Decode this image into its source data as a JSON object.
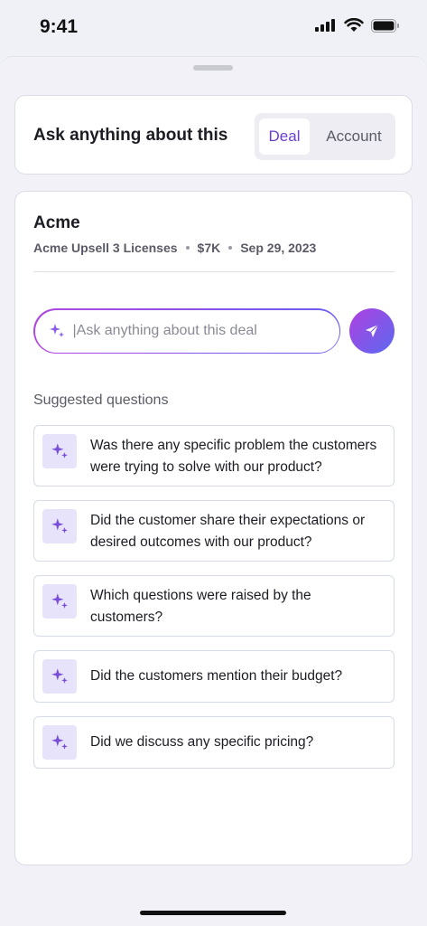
{
  "status_bar": {
    "time": "9:41"
  },
  "ask": {
    "title": "Ask anything about this",
    "tabs": [
      {
        "label": "Deal",
        "selected": true
      },
      {
        "label": "Account",
        "selected": false
      }
    ]
  },
  "deal": {
    "name": "Acme",
    "opportunity": "Acme Upsell 3 Licenses",
    "amount": "$7K",
    "date": "Sep 29, 2023"
  },
  "input": {
    "placeholder": "|Ask anything about this deal"
  },
  "suggested": {
    "title": "Suggested questions",
    "items": [
      "Was there any specific problem the customers were trying to solve with our product?",
      "Did the customer share their expectations or desired outcomes with our product?",
      "Which questions were raised by the customers?",
      "Did the customers mention their budget?",
      "Did we discuss any specific pricing?"
    ]
  },
  "colors": {
    "accent": "#6b3fd0",
    "gradient_start": "#b040e0",
    "gradient_end": "#5a6af0"
  },
  "icons": [
    "signal-icon",
    "wifi-icon",
    "battery-icon",
    "sparkle-icon",
    "send-icon"
  ]
}
